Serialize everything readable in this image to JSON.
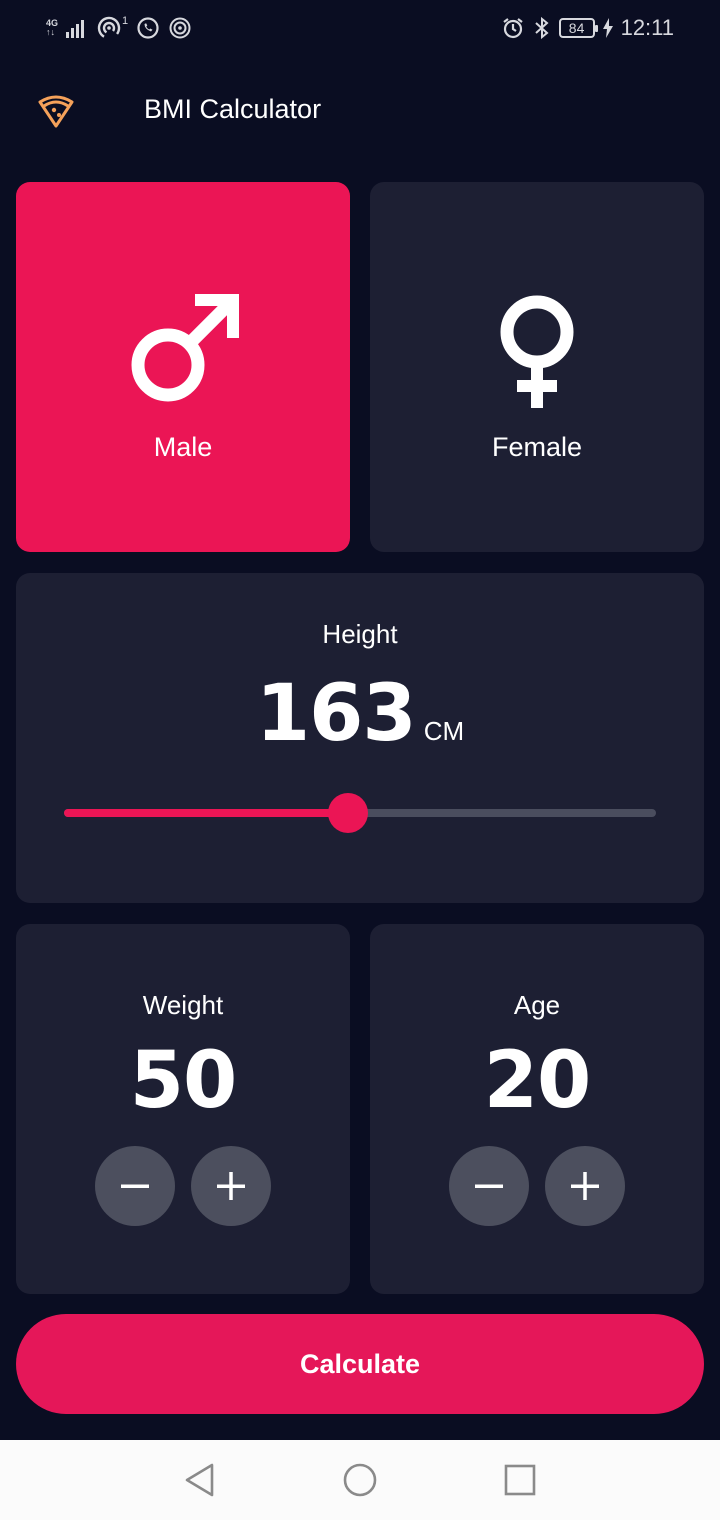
{
  "status_bar": {
    "network": "4G",
    "hotspot_count": "1",
    "battery": "84",
    "time": "12:11",
    "icons": [
      "signal-icon",
      "hotspot-icon",
      "whatsapp-icon",
      "wireless-icon",
      "alarm-icon",
      "bluetooth-icon",
      "battery-icon",
      "charging-icon"
    ]
  },
  "app_bar": {
    "title": "BMI Calculator",
    "logo_icon": "pizza-icon",
    "logo_color": "#f5a15a"
  },
  "gender": {
    "male_label": "Male",
    "female_label": "Female",
    "selected": "male"
  },
  "height": {
    "label": "Height",
    "value": "163",
    "unit": "CM",
    "slider_fraction": 0.48
  },
  "weight": {
    "label": "Weight",
    "value": "50"
  },
  "age": {
    "label": "Age",
    "value": "20"
  },
  "calculate_label": "Calculate",
  "colors": {
    "background": "#0a0d22",
    "card": "#1d1f33",
    "accent": "#eb1555",
    "button": "#4c4f5e",
    "slider_inactive": "#4a4d5e"
  },
  "nav_bar": {
    "icons": [
      "back-icon",
      "home-icon",
      "recents-icon"
    ]
  }
}
